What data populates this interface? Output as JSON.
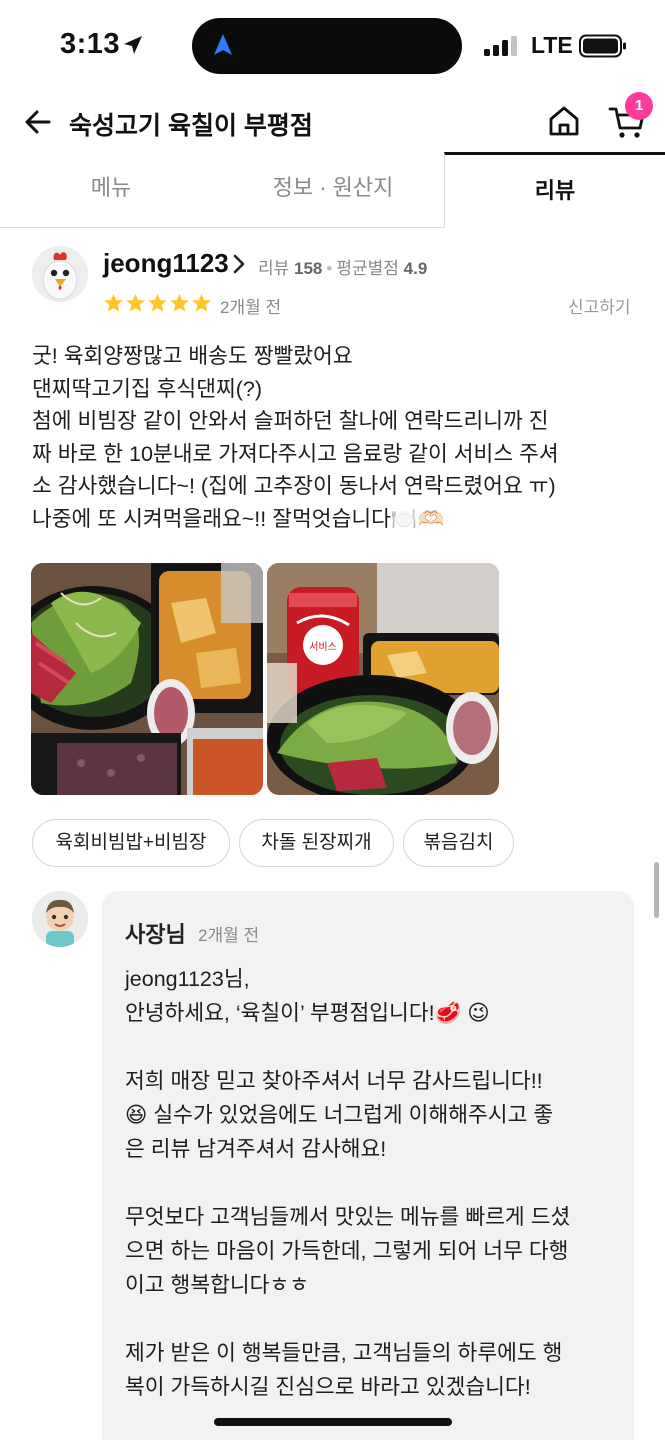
{
  "status_bar": {
    "time": "3:13",
    "network": "LTE",
    "icons": [
      "location-arrow-icon",
      "navigation-icon",
      "signal-icon",
      "battery-icon"
    ]
  },
  "header": {
    "title": "숙성고기 육칠이 부평점",
    "cart_count": "1",
    "icons": [
      "back-arrow-icon",
      "home-icon",
      "cart-icon"
    ]
  },
  "tabs": [
    {
      "label": "메뉴",
      "active": false
    },
    {
      "label": "정보 · 원산지",
      "active": false
    },
    {
      "label": "리뷰",
      "active": true
    }
  ],
  "review": {
    "nickname": "jeong1123",
    "review_label": "리뷰",
    "review_count": "158",
    "avg_label": "평균별점",
    "avg_rating": "4.9",
    "rating": 5,
    "date": "2개월 전",
    "report_label": "신고하기",
    "body_lines": [
      "굿! 육회양짱많고 배송도 짱빨랐어요",
      "댄찌딱고기집 후식댄찌(?)",
      "첨에 비빔장 같이 안와서 슬퍼하던 찰나에 연락드리니까 진",
      "짜 바로 한 10분내로 가져다주시고 음료랑 같이 서비스 주셔",
      "소 감사했습니다~! (집에 고추장이 동나서 연락드렸어요 ㅠ)",
      "나중에 또 시켜먹을래요~!! 잘먹엇습니다🍽️🫶🏻"
    ],
    "photo_caption": "서비스",
    "menu_tags": [
      "육회비빔밥+비빔장",
      "차돌 된장찌개",
      "볶음김치"
    ],
    "colors": {
      "star": "#ffc62b"
    }
  },
  "owner_reply": {
    "name": "사장님",
    "date": "2개월 전",
    "lines": [
      "jeong1123님,",
      "안녕하세요, ‘육칠이’ 부평점입니다!🥩 😉",
      "",
      "저희 매장 믿고 찾아주셔서 너무 감사드립니다!!",
      "😆 실수가 있었음에도 너그럽게 이해해주시고 좋",
      "은 리뷰 남겨주셔서 감사해요!",
      "",
      "무엇보다 고객님들께서 맛있는 메뉴를 빠르게 드셨",
      "으면 하는 마음이 가득한데, 그렇게 되어 너무 다행",
      "이고 행복합니다ㅎㅎ",
      "",
      "제가 받은 이 행복들만큼, 고객님들의 하루에도 행",
      "복이 가득하시길 진심으로 바라고 있겠습니다!"
    ]
  }
}
